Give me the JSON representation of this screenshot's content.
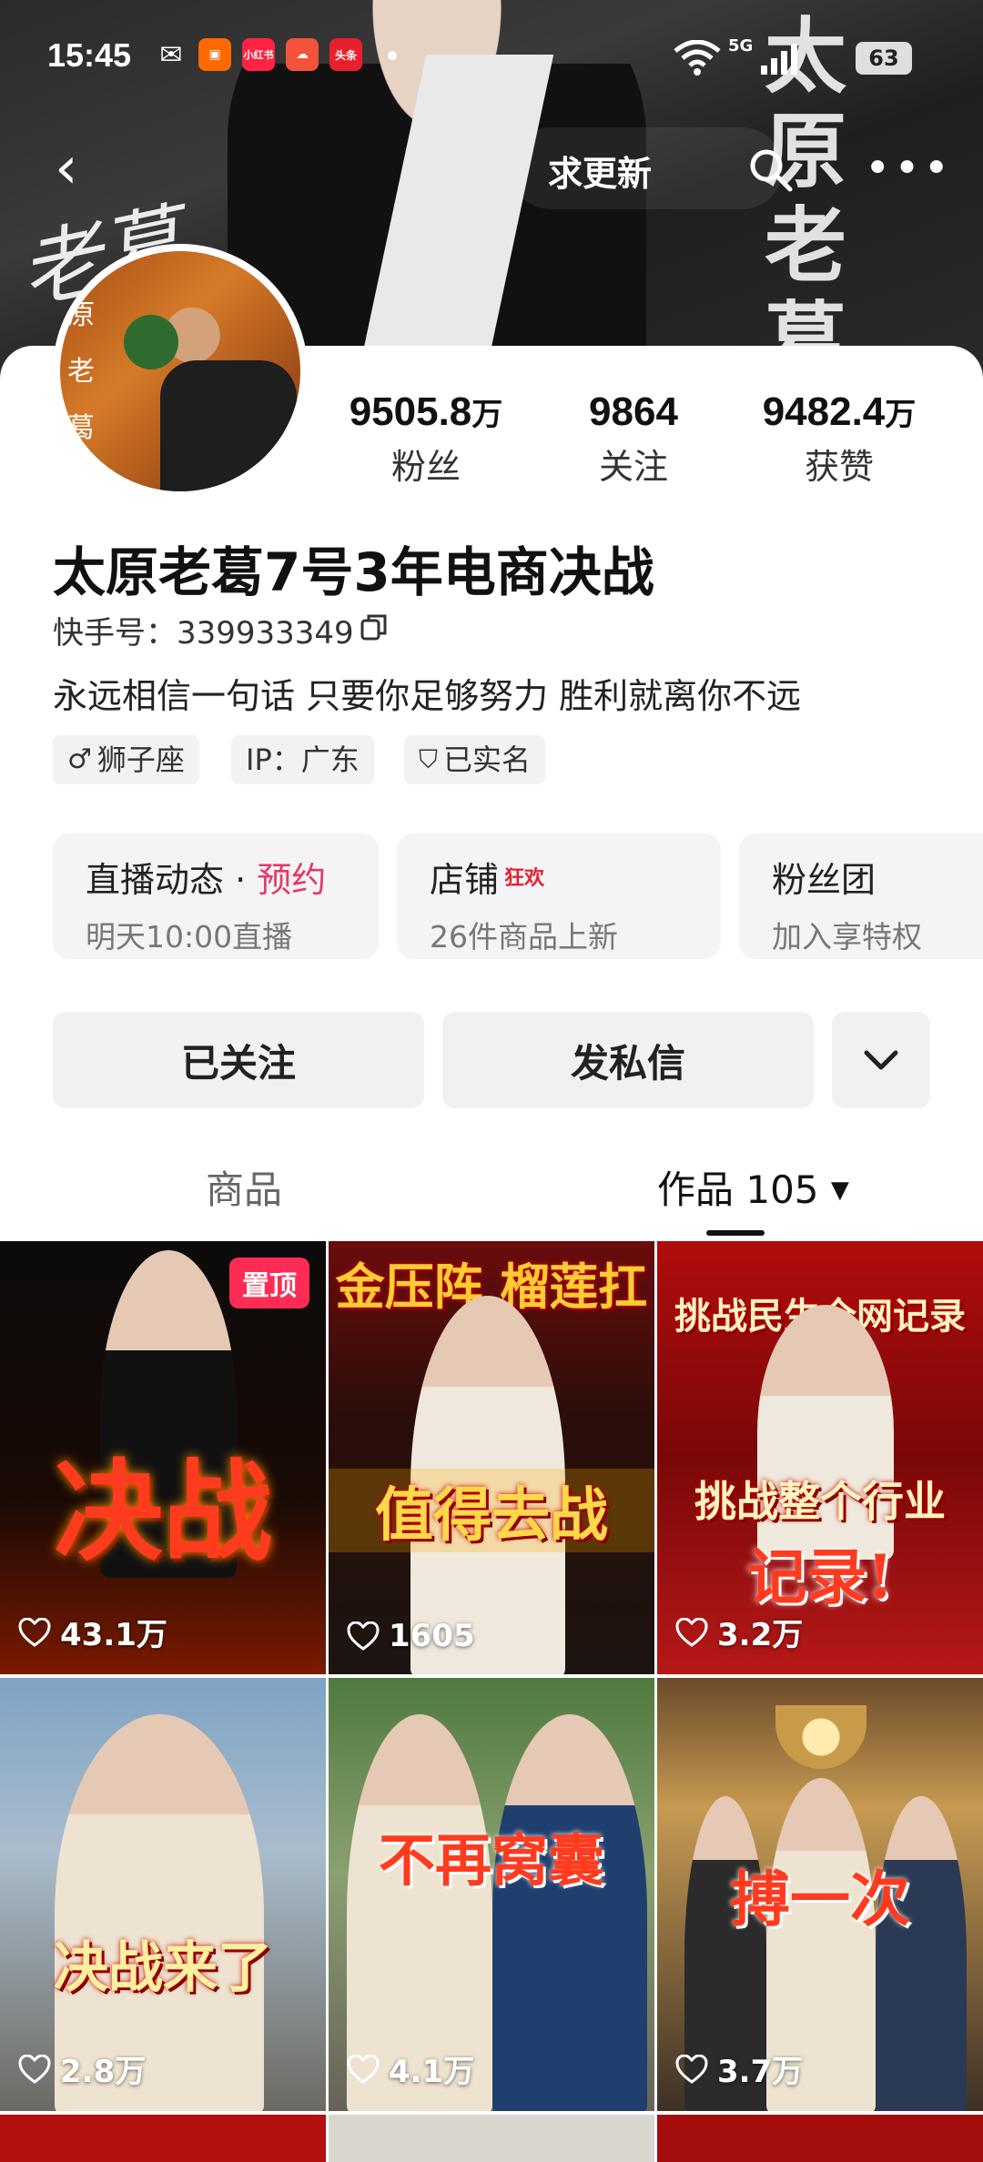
{
  "status_bar": {
    "time": "15:45",
    "battery": "63",
    "network": "5G",
    "notification_icons": [
      "wechat-icon",
      "video-app-icon",
      "xiaohongshu-icon",
      "weather-icon",
      "toutiao-icon"
    ],
    "notification_labels": [
      "",
      "",
      "小红书",
      "",
      "头条"
    ]
  },
  "header": {
    "update_label": "求更新",
    "banner_vertical_text": "太原老葛",
    "signature_text": "老葛"
  },
  "profile": {
    "avatar_text": "原老葛",
    "stats": [
      {
        "value": "9505.8",
        "unit": "万",
        "label": "粉丝"
      },
      {
        "value": "9864",
        "unit": "",
        "label": "关注"
      },
      {
        "value": "9482.4",
        "unit": "万",
        "label": "获赞"
      }
    ],
    "name": "太原老葛7号3年电商决战",
    "kuaishou_id": "快手号：339933349",
    "bio": "永远相信一句话 只要你足够努力 胜利就离你不远",
    "tags": {
      "zodiac": "狮子座",
      "ip": "IP：广东",
      "verified": "已实名"
    }
  },
  "features": {
    "live": {
      "title": "直播动态",
      "sep": " · ",
      "highlight": "预约",
      "subtitle": "明天10:00直播"
    },
    "shop": {
      "title": "店铺",
      "badge": "狂欢",
      "subtitle": "26件商品上新"
    },
    "fans": {
      "title": "粉丝团",
      "subtitle": "加入享特权"
    }
  },
  "actions": {
    "follow": "已关注",
    "message": "发私信",
    "more_icon": "chevron-down-icon"
  },
  "tabs": {
    "goods": "商品",
    "works": "作品 105"
  },
  "videos": [
    {
      "caption": "决战",
      "likes": "43.1万",
      "pinned": "置顶"
    },
    {
      "caption": "值得去战",
      "likes": "1605",
      "top_text": "金压阵 榴莲扛"
    },
    {
      "caption": "挑战整个行业",
      "caption2": "记录!",
      "likes": "3.2万",
      "top_text": "挑战民生全网记录"
    },
    {
      "caption": "决战来了",
      "likes": "2.8万"
    },
    {
      "caption": "不再窝囊",
      "likes": "4.1万"
    },
    {
      "caption": "搏一次",
      "likes": "3.7万"
    }
  ],
  "colors": {
    "accent": "#fe2c55",
    "highlight": "#e63964",
    "caption": "#ffd84a"
  }
}
